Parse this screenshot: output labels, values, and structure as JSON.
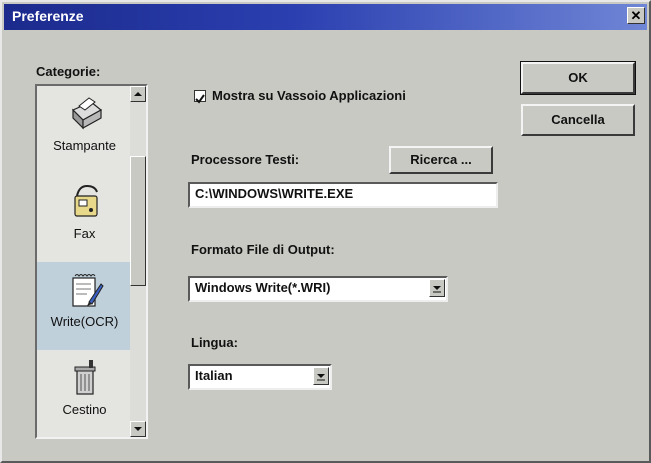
{
  "window": {
    "title": "Preferenze",
    "close_icon": "close-icon"
  },
  "categories": {
    "label": "Categorie:",
    "items": [
      {
        "label": "Stampante",
        "icon": "printer-icon"
      },
      {
        "label": "Fax",
        "icon": "fax-icon"
      },
      {
        "label": "Write(OCR)",
        "icon": "write-ocr-icon",
        "selected": true
      },
      {
        "label": "Cestino",
        "icon": "trash-bin-icon"
      }
    ]
  },
  "options": {
    "tray_checkbox_label": "Mostra su Vassoio Applicazioni",
    "tray_checked": true
  },
  "processor": {
    "label": "Processore Testi:",
    "browse_label": "Ricerca ...",
    "path": "C:\\WINDOWS\\WRITE.EXE"
  },
  "output_format": {
    "label": "Formato File di Output:",
    "selected": "Windows Write(*.WRI)"
  },
  "language": {
    "label": "Lingua:",
    "selected": "Italian"
  },
  "buttons": {
    "ok": "OK",
    "cancel": "Cancella"
  }
}
